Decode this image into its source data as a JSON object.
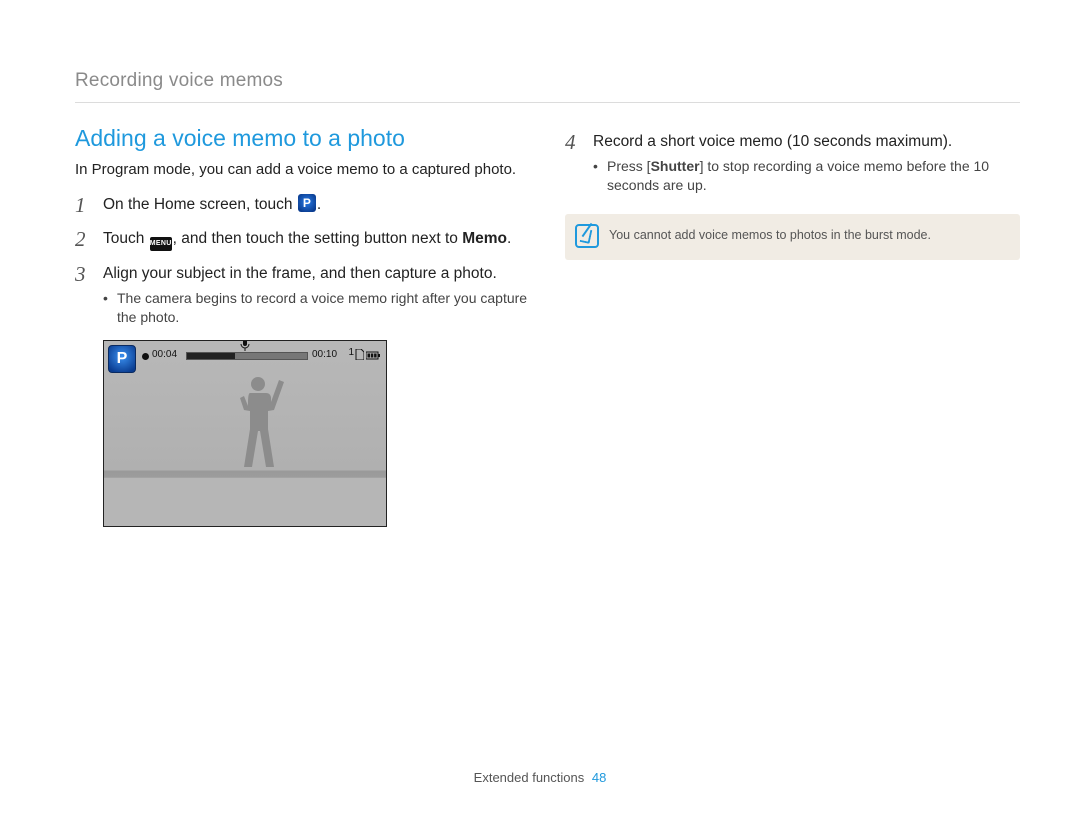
{
  "breadcrumb": "Recording voice memos",
  "section_title": "Adding a voice memo to a photo",
  "intro": "In Program mode, you can add a voice memo to a captured photo.",
  "steps": {
    "s1": {
      "num": "1",
      "pre": "On the Home screen, touch ",
      "post": "."
    },
    "s2": {
      "num": "2",
      "pre": "Touch ",
      "mid": ", and then touch the setting button next to ",
      "bold": "Memo",
      "post": "."
    },
    "s3": {
      "num": "3",
      "text": "Align your subject in the frame, and then capture a photo.",
      "sub1": "The camera begins to record a voice memo right after you capture the photo."
    },
    "s4": {
      "num": "4",
      "text": "Record a short voice memo (10 seconds maximum).",
      "sub1_pre": "Press [",
      "sub1_bold": "Shutter",
      "sub1_post": "] to stop recording a voice memo before the 10 seconds are up."
    }
  },
  "camera": {
    "elapsed": "00:04",
    "total": "00:10",
    "count": "1"
  },
  "menu_label": "MENU",
  "tip": "You cannot add voice memos to photos in the burst mode.",
  "footer_section": "Extended functions",
  "footer_page": "48"
}
